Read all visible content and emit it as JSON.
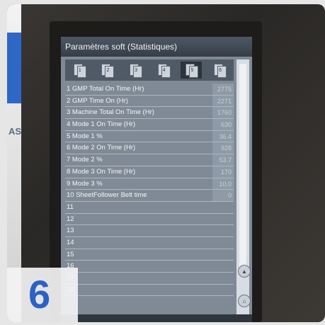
{
  "background": {
    "wall_text": "AS",
    "accent_color": "#2f67c7"
  },
  "screen": {
    "title": "Paramètres soft (Statistiques)",
    "tabs": [
      {
        "label": "1",
        "active": false
      },
      {
        "label": "2",
        "active": false
      },
      {
        "label": "3",
        "active": false
      },
      {
        "label": "4",
        "active": false
      },
      {
        "label": "5",
        "active": true
      },
      {
        "label": "6",
        "active": false
      }
    ],
    "rows": [
      {
        "label": "1 GMP Total On Time (Hr)",
        "value": "2775"
      },
      {
        "label": "2 GMP Time On (Hr)",
        "value": "2271"
      },
      {
        "label": "3 Machine Total On Time (Hr)",
        "value": "1760"
      },
      {
        "label": "4 Mode 1 On Time (Hr)",
        "value": "630"
      },
      {
        "label": "5 Mode 1 %",
        "value": "36.4"
      },
      {
        "label": "6 Mode 2 On Time (Hr)",
        "value": "928"
      },
      {
        "label": "7 Mode 2 %",
        "value": "53.7"
      },
      {
        "label": "8 Mode 3 On Time (Hr)",
        "value": "170"
      },
      {
        "label": "9 Mode 3 %",
        "value": "10.0"
      },
      {
        "label": "10 SheetFollower Belt time",
        "value": "0"
      },
      {
        "label": "11",
        "value": ""
      },
      {
        "label": "12",
        "value": ""
      },
      {
        "label": "13",
        "value": ""
      },
      {
        "label": "14",
        "value": ""
      },
      {
        "label": "15",
        "value": ""
      },
      {
        "label": "16",
        "value": ""
      },
      {
        "label": "17",
        "value": ""
      },
      {
        "label": "18",
        "value": ""
      }
    ],
    "scroll": {
      "up_icon": "up-arrow-icon",
      "home_icon": "home-icon"
    }
  },
  "overlay": {
    "step_number": "6"
  }
}
